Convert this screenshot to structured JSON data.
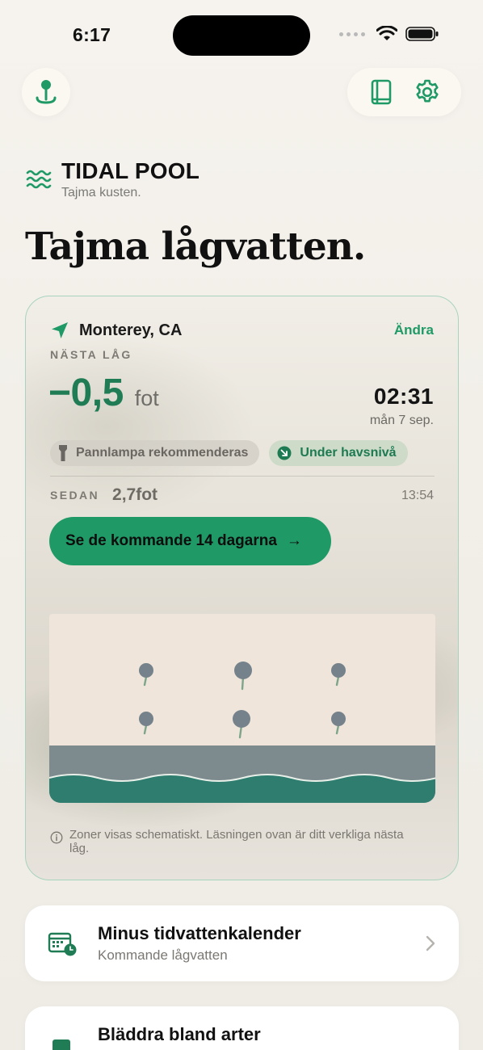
{
  "status_bar": {
    "time": "6:17"
  },
  "colors": {
    "accent": "#1f9a66",
    "accent_dark": "#1f7c55",
    "card_border": "#a8d3bf"
  },
  "toolbar": {
    "pin_icon": "map-pin-icon",
    "book_icon": "book-icon",
    "settings_icon": "gear-icon"
  },
  "brand": {
    "title": "TIDAL POOL",
    "subtitle": "Tajma kusten.",
    "icon": "waves-icon"
  },
  "headline": "Tajma lågvatten.",
  "tide_card": {
    "location": "Monterey, CA",
    "change_label": "Ändra",
    "next_low_label": "NÄSTA LÅG",
    "height_value": "−0,5",
    "height_unit": "fot",
    "low_time": "02:31",
    "low_date": "mån 7 sep.",
    "chips": [
      {
        "label": "Pannlampa rekommenderas",
        "icon": "flashlight-icon"
      },
      {
        "label": "Under havsnivå",
        "icon": "arrow-down-right-icon"
      }
    ],
    "since_label": "SEDAN",
    "since_value": "2,7fot",
    "since_time": "13:54",
    "cta_label": "Se de kommande 14 dagarna",
    "cta_arrow": "→",
    "note": "Zoner visas schematiskt. Läsningen ovan är ditt verkliga nästa låg."
  },
  "list": [
    {
      "title": "Minus tidvattenkalender",
      "subtitle": "Kommande lågvatten",
      "icon": "calendar-clock-icon"
    },
    {
      "title": "Bläddra bland arter",
      "subtitle": "",
      "icon": "book-icon"
    }
  ]
}
